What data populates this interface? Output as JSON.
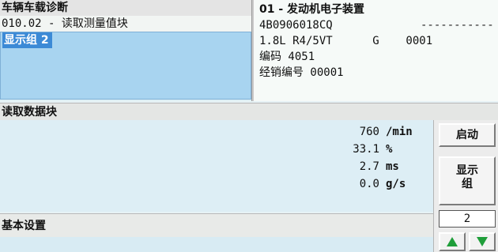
{
  "header": {
    "app_title": "车辆车载诊断",
    "function_line": "010.02 - 读取测量值块",
    "selected_group_label": "显示组 2"
  },
  "ecu": {
    "line1": "01 - 发动机电子装置",
    "part_number": "4B0906018CQ",
    "dashes": "-----------",
    "engine_line": "1.8L R4/5VT      G    0001",
    "coding": "编码 4051",
    "dealer": "经销编号 00001"
  },
  "section_title": "读取数据块",
  "measurements": [
    {
      "value": "760",
      "unit": "/min"
    },
    {
      "value": "33.1",
      "unit": "%"
    },
    {
      "value": "2.7",
      "unit": "ms"
    },
    {
      "value": "0.0",
      "unit": "g/s"
    }
  ],
  "basic_setting_label": "基本设置",
  "controls": {
    "start_label": "启动",
    "display_label_line1": "显示",
    "display_label_line2": "组",
    "group_number": "2"
  },
  "colors": {
    "selection_bg": "#a8d4f0",
    "highlight": "#3c8ad6",
    "arrow_green": "#1f9e3a"
  }
}
